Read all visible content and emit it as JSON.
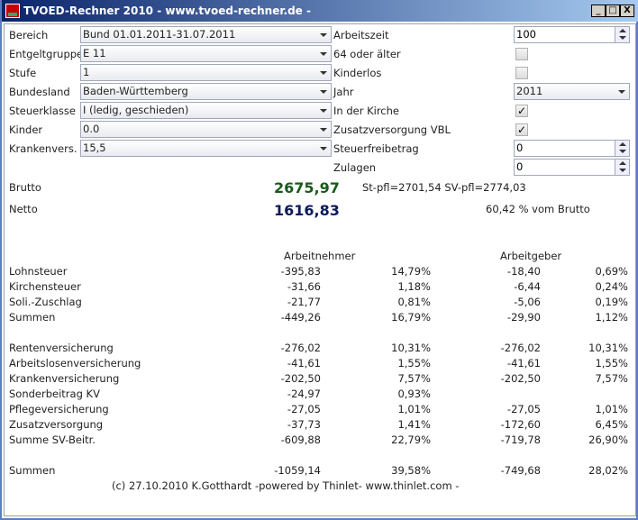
{
  "window": {
    "title": "TVOED-Rechner 2010 - www.tvoed-rechner.de -",
    "min": "_",
    "max": "□",
    "close": "X"
  },
  "form_left": [
    {
      "label": "Bereich",
      "value": "Bund 01.01.2011-31.07.2011"
    },
    {
      "label": "Entgeltgruppe",
      "value": "E 11"
    },
    {
      "label": "Stufe",
      "value": "1"
    },
    {
      "label": "Bundesland",
      "value": "Baden-Württemberg"
    },
    {
      "label": "Steuerklasse",
      "value": "I (ledig, geschieden)"
    },
    {
      "label": "Kinder",
      "value": "0.0"
    },
    {
      "label": "Krankenvers.",
      "value": "15,5"
    }
  ],
  "form_right": {
    "arbeitszeit": {
      "label": "Arbeitszeit",
      "value": "100"
    },
    "alter64": {
      "label": "64 oder älter",
      "checked": false
    },
    "kinderlos": {
      "label": "Kinderlos",
      "checked": false
    },
    "jahr": {
      "label": "Jahr",
      "value": "2011"
    },
    "kirche": {
      "label": "In der Kirche",
      "checked": true,
      "mark": "✓"
    },
    "vbl": {
      "label": "Zusatzversorgung VBL",
      "checked": true,
      "mark": "✓"
    },
    "steuerfreibetrag": {
      "label": "Steuerfreibetrag",
      "value": "0"
    },
    "zulagen": {
      "label": "Zulagen",
      "value": "0"
    }
  },
  "results": {
    "brutto_label": "Brutto",
    "brutto": "2675,97",
    "pflichtig": "St-pfl=2701,54 SV-pfl=2774,03",
    "netto_label": "Netto",
    "netto": "1616,83",
    "netto_pct": "60,42 % vom Brutto",
    "brutto_color": "#1a5a1a",
    "netto_color": "#0a1a5a"
  },
  "table": {
    "header_an": "Arbeitnehmer",
    "header_ag": "Arbeitgeber",
    "rows": [
      {
        "label": "Lohnsteuer",
        "an": "-395,83",
        "an_pct": "14,79%",
        "ag": "-18,40",
        "ag_pct": "0,69%"
      },
      {
        "label": "Kirchensteuer",
        "an": "-31,66",
        "an_pct": "1,18%",
        "ag": "-6,44",
        "ag_pct": "0,24%"
      },
      {
        "label": "Soli.-Zuschlag",
        "an": "-21,77",
        "an_pct": "0,81%",
        "ag": "-5,06",
        "ag_pct": "0,19%"
      },
      {
        "label": "Summen",
        "an": "-449,26",
        "an_pct": "16,79%",
        "ag": "-29,90",
        "ag_pct": "1,12%"
      },
      {
        "label": "Rentenversicherung",
        "an": "-276,02",
        "an_pct": "10,31%",
        "ag": "-276,02",
        "ag_pct": "10,31%"
      },
      {
        "label": "Arbeitslosenversicherung",
        "an": "-41,61",
        "an_pct": "1,55%",
        "ag": "-41,61",
        "ag_pct": "1,55%"
      },
      {
        "label": "Krankenversicherung",
        "an": "-202,50",
        "an_pct": "7,57%",
        "ag": "-202,50",
        "ag_pct": "7,57%"
      },
      {
        "label": "Sonderbeitrag KV",
        "an": "-24,97",
        "an_pct": "0,93%",
        "ag": "",
        "ag_pct": ""
      },
      {
        "label": "Pflegeversicherung",
        "an": "-27,05",
        "an_pct": "1,01%",
        "ag": "-27,05",
        "ag_pct": "1,01%"
      },
      {
        "label": "Zusatzversorgung",
        "an": "-37,73",
        "an_pct": "1,41%",
        "ag": "-172,60",
        "ag_pct": "6,45%"
      },
      {
        "label": "Summe SV-Beitr.",
        "an": "-609,88",
        "an_pct": "22,79%",
        "ag": "-719,78",
        "ag_pct": "26,90%"
      },
      {
        "label": "Summen",
        "an": "-1059,14",
        "an_pct": "39,58%",
        "ag": "-749,68",
        "ag_pct": "28,02%"
      }
    ]
  },
  "footer": "(c) 27.10.2010 K.Gotthardt -powered by Thinlet- www.thinlet.com -"
}
